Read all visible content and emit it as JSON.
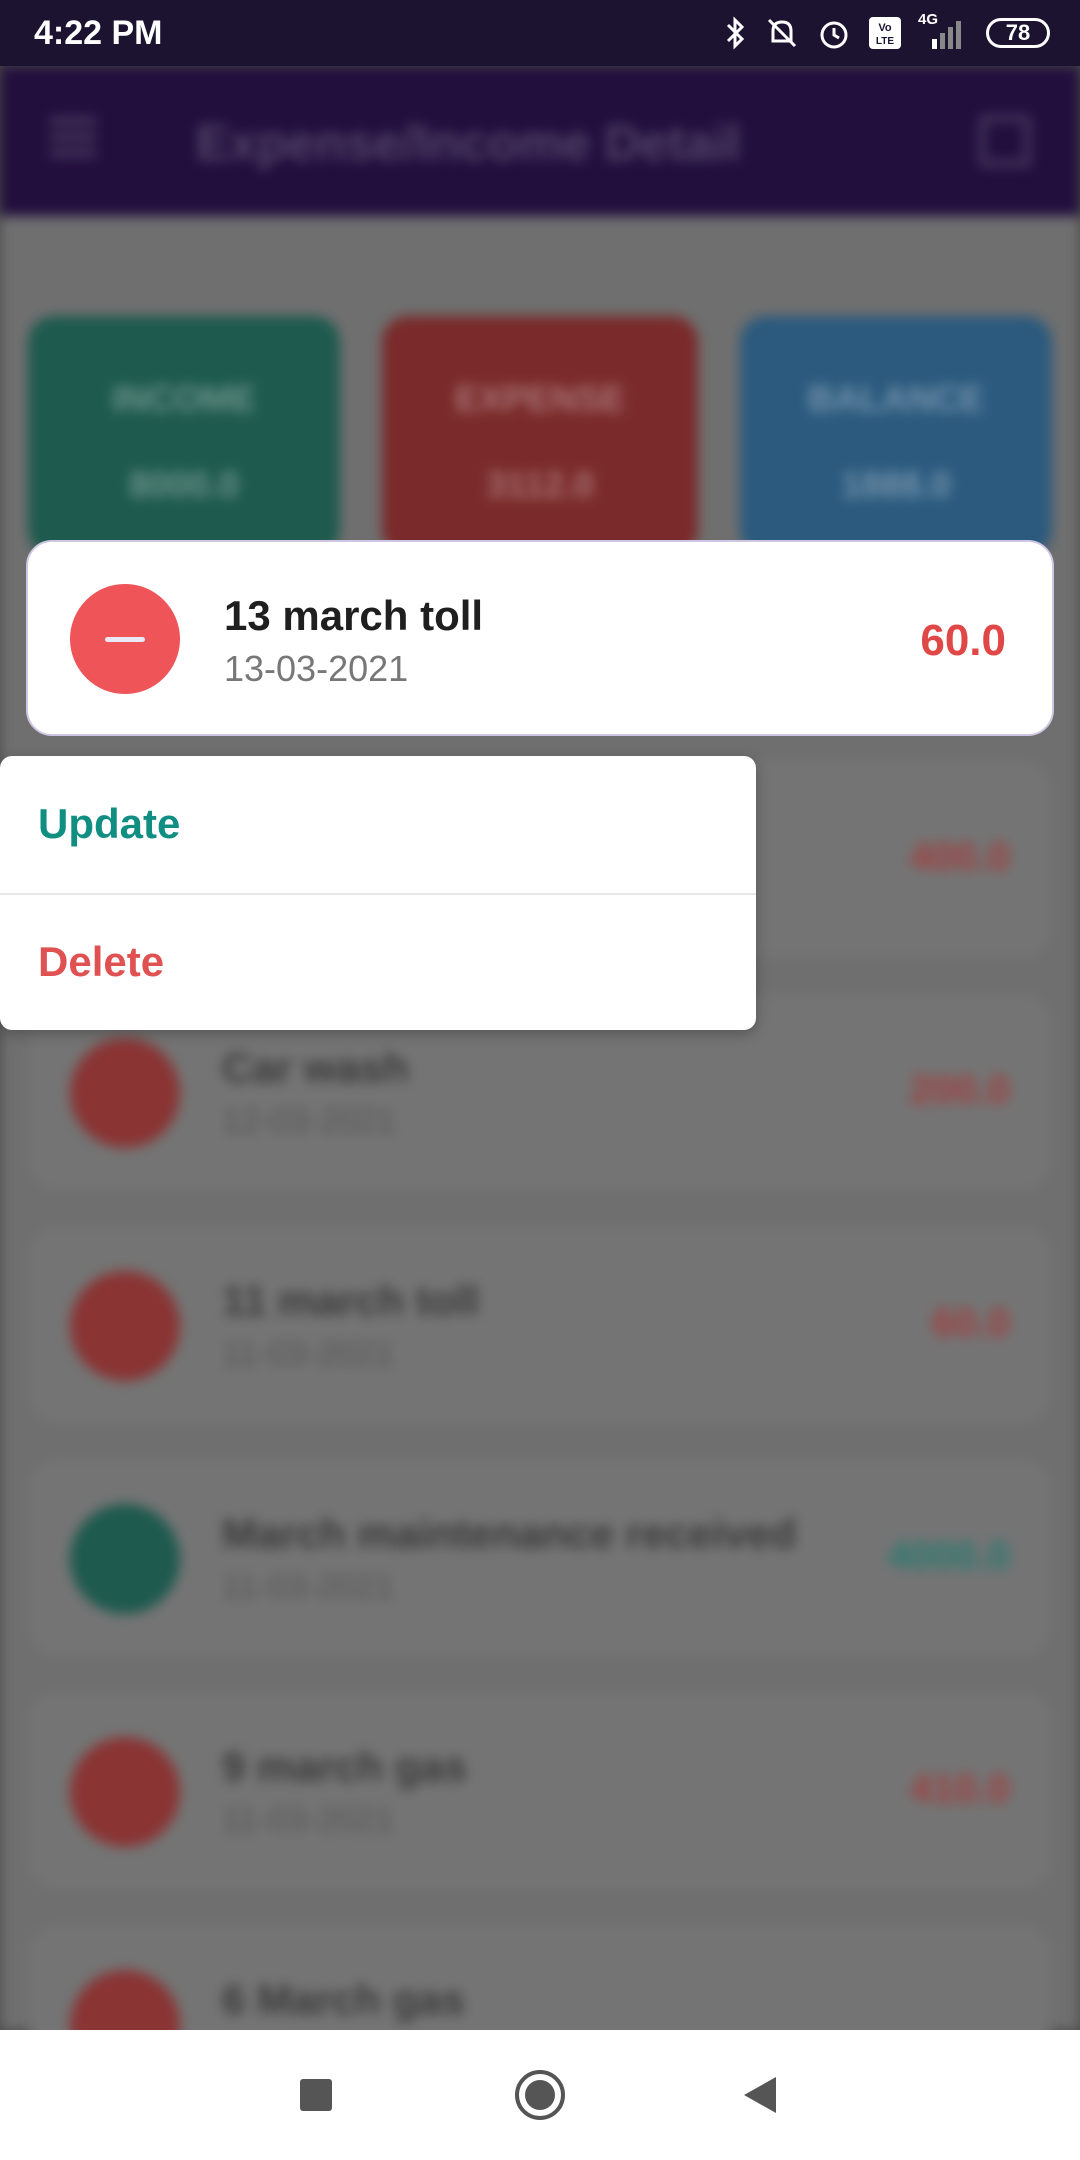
{
  "status_bar": {
    "time": "4:22 PM",
    "network": "4G",
    "battery": "78"
  },
  "app_bar": {
    "title": "Expense/Income Detail"
  },
  "summary": {
    "income_label": "INCOME",
    "income_value": "8000.0",
    "expense_label": "EXPENSE",
    "expense_value": "3112.0",
    "balance_label": "BALANCE",
    "balance_value": "1888.0"
  },
  "selected_item": {
    "title": "13 march toll",
    "date": "13-03-2021",
    "amount": "60.0"
  },
  "context_menu": {
    "update_label": "Update",
    "delete_label": "Delete"
  },
  "background_items": [
    {
      "title": "",
      "date": "",
      "amount": "400.0",
      "type": "expense"
    },
    {
      "title": "Car wash",
      "date": "12-03-2021",
      "amount": "200.0",
      "type": "expense"
    },
    {
      "title": "11 march toll",
      "date": "11-03-2021",
      "amount": "60.0",
      "type": "expense"
    },
    {
      "title": "March maintenance received",
      "date": "11-03-2021",
      "amount": "4000.0",
      "type": "income"
    },
    {
      "title": "9 march gas",
      "date": "11-03-2021",
      "amount": "410.0",
      "type": "expense"
    },
    {
      "title": "6 March gas",
      "date": "",
      "amount": "",
      "type": "expense"
    }
  ],
  "colors": {
    "status_bar": "#1b1330",
    "app_bar": "#3d1a6b",
    "expense": "#ef5558",
    "income": "#118e82",
    "balance": "#2a6fb0"
  }
}
